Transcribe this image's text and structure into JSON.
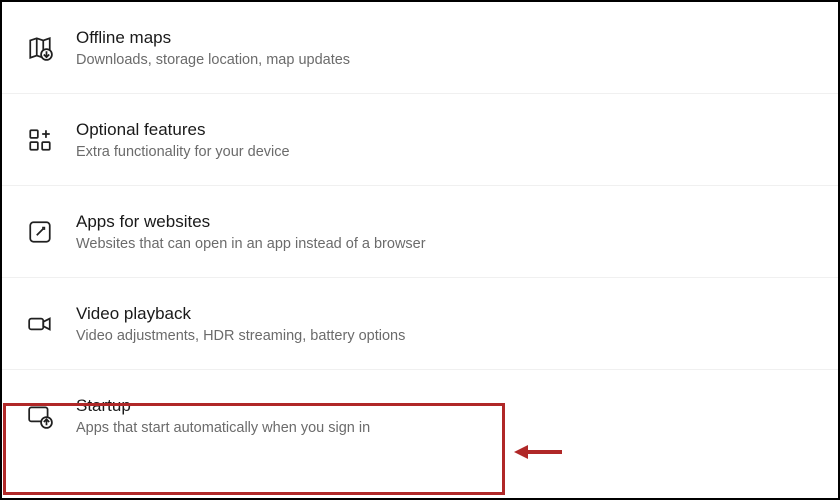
{
  "settings": {
    "items": [
      {
        "id": "offline-maps",
        "title": "Offline maps",
        "desc": "Downloads, storage location, map updates",
        "iconName": "map-download-icon"
      },
      {
        "id": "optional-features",
        "title": "Optional features",
        "desc": "Extra functionality for your device",
        "iconName": "grid-plus-icon"
      },
      {
        "id": "apps-for-websites",
        "title": "Apps for websites",
        "desc": "Websites that can open in an app instead of a browser",
        "iconName": "link-square-icon"
      },
      {
        "id": "video-playback",
        "title": "Video playback",
        "desc": "Video adjustments, HDR streaming, battery options",
        "iconName": "video-camera-icon"
      },
      {
        "id": "startup",
        "title": "Startup",
        "desc": "Apps that start automatically when you sign in",
        "iconName": "startup-icon"
      }
    ]
  },
  "annotations": {
    "highlight_target": "startup",
    "arrow_color": "#b02828"
  }
}
